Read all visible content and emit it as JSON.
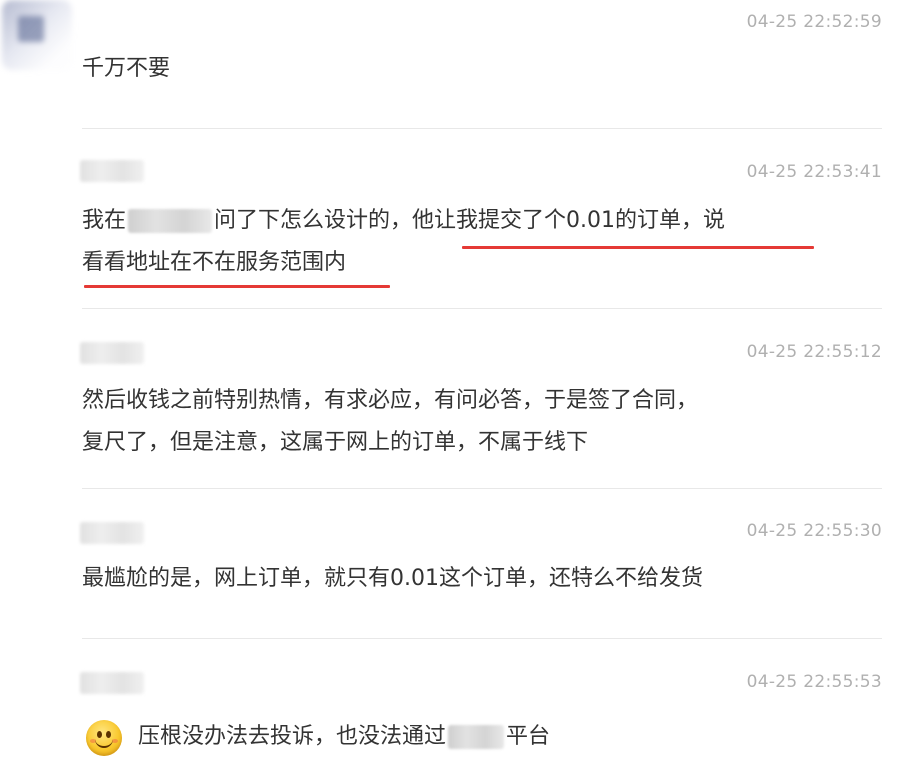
{
  "comments": [
    {
      "time": "04-25 22:52:59",
      "text": "千万不要"
    },
    {
      "time": "04-25 22:53:41",
      "text_part1": "我在",
      "text_part2": "问了下怎么设计的，他让我提交了个0.01的订单，说",
      "text_line2": "看看地址在不在服务范围内"
    },
    {
      "time": "04-25 22:55:12",
      "text_line1": "然后收钱之前特别热情，有求必应，有问必答，于是签了合同，",
      "text_line2": "复尺了，但是注意，这属于网上的订单，不属于线下"
    },
    {
      "time": "04-25 22:55:30",
      "text": "最尴尬的是，网上订单，就只有0.01这个订单，还特么不给发货"
    },
    {
      "time": "04-25 22:55:53",
      "emoji": "smiley-emoji",
      "text_part1": "压根没办法去投诉，也没法通过",
      "text_part2": "平台"
    }
  ],
  "colors": {
    "text": "#333333",
    "timestamp": "#b0b0b0",
    "divider": "#e8e8e8",
    "highlight_underline": "#e53935"
  }
}
